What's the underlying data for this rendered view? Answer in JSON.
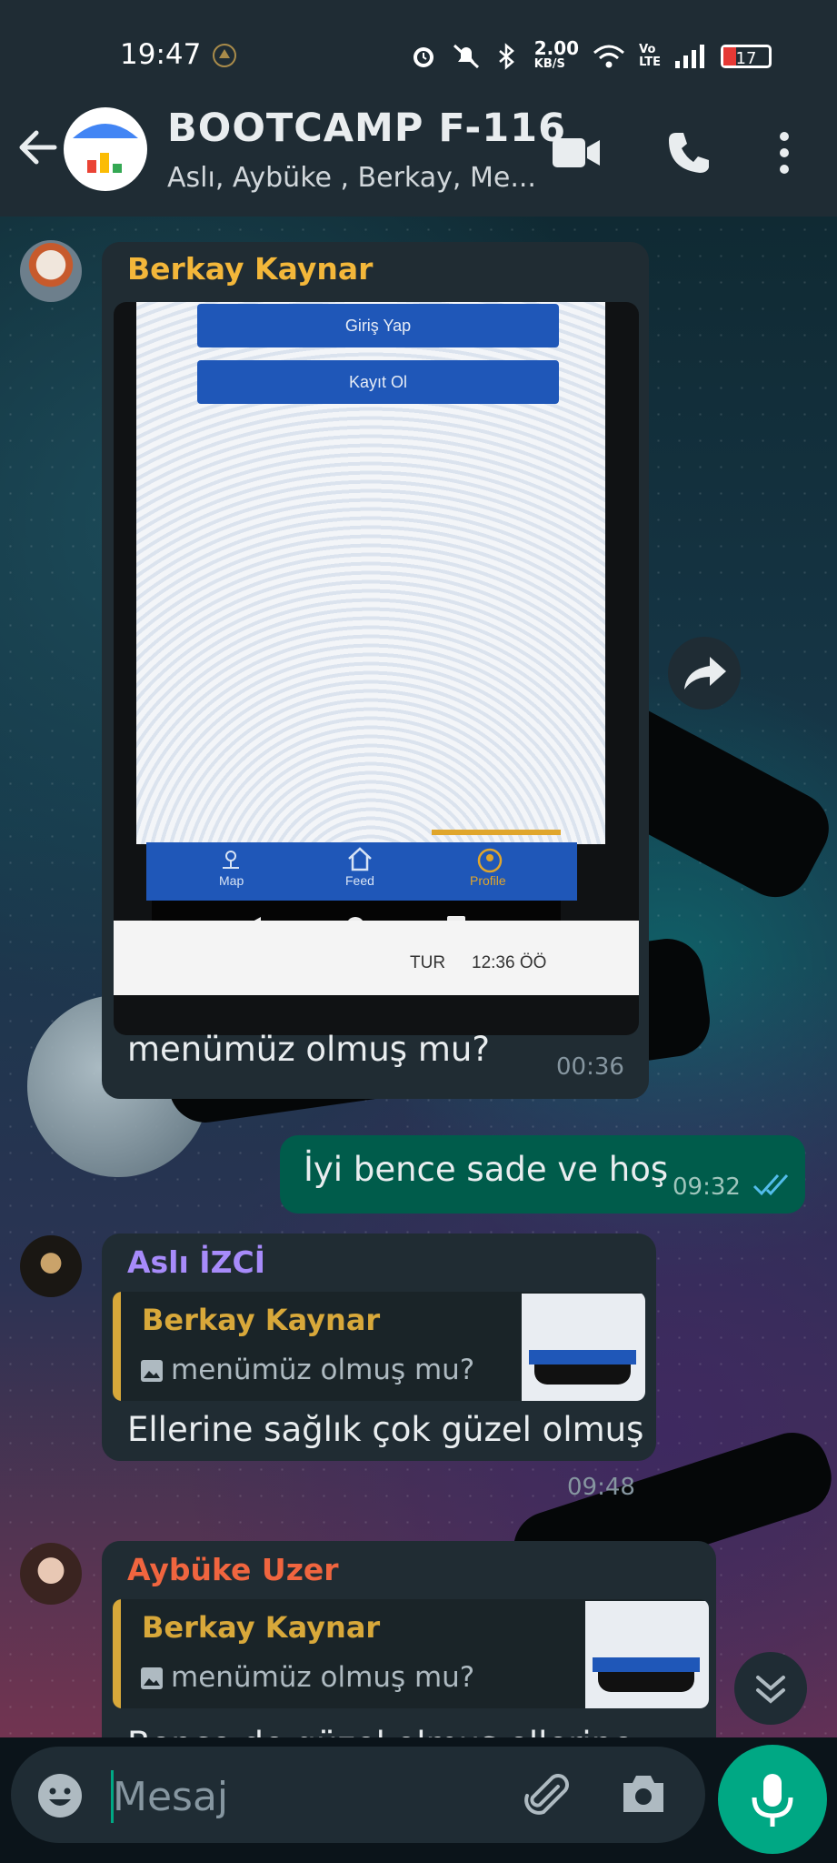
{
  "status_bar": {
    "time": "19:47",
    "net_speed_top": "2.00",
    "net_speed_bottom": "KB/S",
    "battery": "17",
    "volte_top": "Vo",
    "volte_bottom": "LTE"
  },
  "header": {
    "title": "BOOTCAMP F-116",
    "subtitle": "Aslı, Aybüke , Berkay, Me..."
  },
  "messages": [
    {
      "sender": "Berkay Kaynar",
      "sender_color": "#f3b73a",
      "caption": "menümüz olmuş mu?",
      "time": "00:36",
      "photo": {
        "button1": "Giriş Yap",
        "button2": "Kayıt Ol",
        "nav": [
          "Map",
          "Feed",
          "Profile"
        ],
        "taskbar_lang": "TUR",
        "taskbar_time": "12:36 ÖÖ"
      }
    },
    {
      "outgoing": true,
      "text": "İyi bence sade ve hoş",
      "time": "09:32"
    },
    {
      "sender": "Aslı İZCİ",
      "sender_color": "#a78bfa",
      "quote_sender": "Berkay Kaynar",
      "quote_text": "menümüz olmuş mu?",
      "text": "Ellerine sağlık çok güzel olmuş",
      "time": "09:48"
    },
    {
      "sender": "Aybüke Uzer",
      "sender_color": "#f0653f",
      "quote_sender": "Berkay Kaynar",
      "quote_text": "menümüz olmuş mu?",
      "text_partial": "Bence de güzel olmuş ellerine"
    }
  ],
  "composer": {
    "placeholder": "Mesaj"
  },
  "colors": {
    "accent": "#00a884",
    "header_bg": "#1f2c34",
    "bubble_in": "#202c33",
    "bubble_out": "#005c4b",
    "quote_accent": "#d8a83a",
    "read_ticks": "#53bdeb"
  }
}
